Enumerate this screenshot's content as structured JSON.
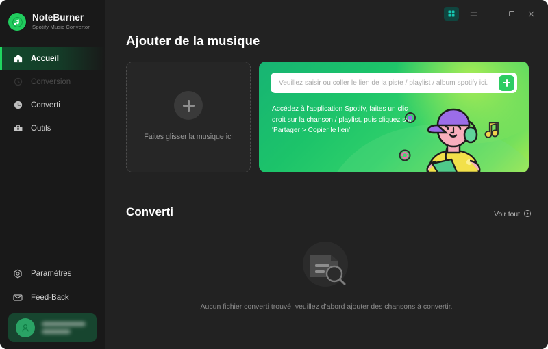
{
  "app": {
    "brand_name": "NoteBurner",
    "brand_subtitle": "Spotify Music Convertor"
  },
  "titlebar": {
    "grid_icon": "grid-apps-icon",
    "menu_icon": "hamburger-menu-icon",
    "minimize_icon": "minimize-icon",
    "maximize_icon": "maximize-icon",
    "close_icon": "close-icon"
  },
  "sidebar": {
    "items": [
      {
        "label": "Accueil",
        "icon": "home-icon",
        "active": true,
        "disabled": false
      },
      {
        "label": "Conversion",
        "icon": "refresh-icon",
        "active": false,
        "disabled": true
      },
      {
        "label": "Converti",
        "icon": "clock-icon",
        "active": false,
        "disabled": false
      },
      {
        "label": "Outils",
        "icon": "toolbox-icon",
        "active": false,
        "disabled": false
      }
    ],
    "bottom_items": [
      {
        "label": "Paramètres",
        "icon": "gear-icon"
      },
      {
        "label": "Feed-Back",
        "icon": "mail-icon"
      }
    ],
    "account": {
      "avatar_icon": "user-avatar-icon",
      "name_masked": "",
      "plan_masked": ""
    }
  },
  "main": {
    "page_title": "Ajouter de la musique",
    "dropzone": {
      "plus_icon": "plus-icon",
      "label": "Faites glisser la musique ici"
    },
    "green_card": {
      "search_placeholder": "Veuillez saisir ou coller le lien de la piste / playlist / album spotify ici.",
      "search_value": "",
      "add_button_icon": "plus-icon",
      "help_text": "Accédez à l'application Spotify, faites un clic droit sur la chanson / playlist, puis cliquez sur 'Partager > Copier le lien'",
      "illustration": "person-listening-music-illustration"
    },
    "converted_section": {
      "title": "Converti",
      "see_all_label": "Voir tout",
      "see_all_icon": "chevron-right-circle-icon",
      "empty_icon": "file-search-icon",
      "empty_text": "Aucun fichier converti trouvé, veuillez d'abord ajouter des chansons à convertir."
    }
  },
  "colors": {
    "accent_green": "#1fd760",
    "card_green": "#2fd06a",
    "sidebar_bg": "#191919",
    "main_bg": "#222222",
    "titlebar_active": "#16c8b3"
  }
}
